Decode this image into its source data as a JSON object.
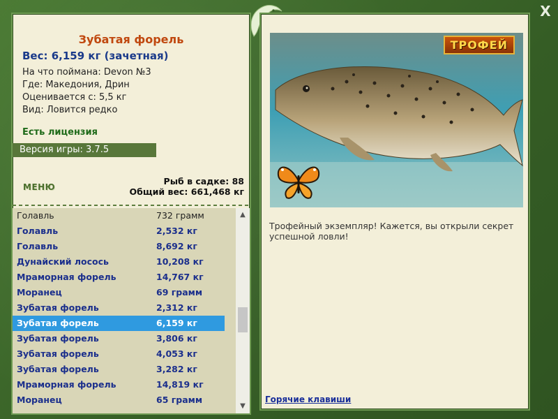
{
  "fish": {
    "title": "Зубатая форель",
    "weight_line": "Вес: 6,159 кг (зачетная)",
    "details": [
      "На что поймана: Devon №3",
      "Где: Македония, Дрин",
      "Оценивается с: 5,5 кг",
      "Вид: Ловится редко"
    ]
  },
  "license_label": "Есть лицензия",
  "version_label": "Версия игры: 3.7.5",
  "menu_label": "МЕНЮ",
  "stats": {
    "fish_in_keepnet": "Рыб в садке: 88",
    "total_weight": "Общий вес: 661,468 кг"
  },
  "catch_list": [
    {
      "name": "Голавль",
      "weight": "732 грамм",
      "style": "plain"
    },
    {
      "name": "Голавль",
      "weight": "2,532 кг",
      "style": "bold"
    },
    {
      "name": "Голавль",
      "weight": "8,692 кг",
      "style": "bold"
    },
    {
      "name": "Дунайский лосось",
      "weight": "10,208 кг",
      "style": "bold"
    },
    {
      "name": "Мраморная форель",
      "weight": "14,767 кг",
      "style": "bold"
    },
    {
      "name": "Моранец",
      "weight": "69 грамм",
      "style": "bold"
    },
    {
      "name": "Зубатая форель",
      "weight": "2,312 кг",
      "style": "bold"
    },
    {
      "name": "Зубатая форель",
      "weight": "6,159 кг",
      "style": "selected"
    },
    {
      "name": "Зубатая форель",
      "weight": "3,806 кг",
      "style": "bold"
    },
    {
      "name": "Зубатая форель",
      "weight": "4,053 кг",
      "style": "bold"
    },
    {
      "name": "Зубатая форель",
      "weight": "3,282 кг",
      "style": "bold"
    },
    {
      "name": "Мраморная форель",
      "weight": "14,819 кг",
      "style": "bold"
    },
    {
      "name": "Моранец",
      "weight": "65 грамм",
      "style": "bold"
    }
  ],
  "trophy_badge": "ТРОФЕЙ",
  "description": "Трофейный экземпляр! Кажется, вы открыли секрет успешной ловли!",
  "hotkeys_link": "Горячие клавиши",
  "close_label": "X",
  "icons": {
    "close": "close-icon",
    "scroll_up": "chevron-up-icon",
    "scroll_down": "chevron-down-icon",
    "logo": "fish-logo-icon",
    "butterfly": "butterfly-icon"
  },
  "colors": {
    "frame": "#3e6b2c",
    "panel": "#f3efd9",
    "title": "#c0480f",
    "weight": "#1a3a8a",
    "license": "#1f6b1a",
    "selection": "#2f9ae0"
  }
}
